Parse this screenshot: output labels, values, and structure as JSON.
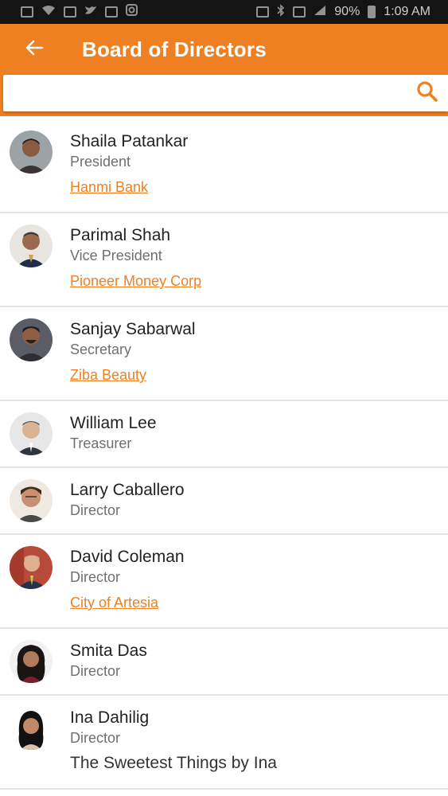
{
  "status_bar": {
    "battery": "90%",
    "time": "1:09 AM"
  },
  "header": {
    "title": "Board of Directors"
  },
  "search": {
    "placeholder": "",
    "value": ""
  },
  "colors": {
    "accent": "#ef8022",
    "status_bar": "#141414",
    "divider": "#e3e3e3"
  },
  "members": [
    {
      "name": "Shaila Patankar",
      "role": "President",
      "company": "Hanmi Bank",
      "company_is_link": true
    },
    {
      "name": "Parimal Shah",
      "role": "Vice President",
      "company": "Pioneer Money Corp",
      "company_is_link": true
    },
    {
      "name": "Sanjay Sabarwal",
      "role": "Secretary",
      "company": "Ziba Beauty",
      "company_is_link": true
    },
    {
      "name": "William Lee",
      "role": "Treasurer",
      "company": "",
      "company_is_link": false
    },
    {
      "name": "Larry Caballero",
      "role": "Director",
      "company": "",
      "company_is_link": false
    },
    {
      "name": "David Coleman",
      "role": "Director",
      "company": "City of Artesia",
      "company_is_link": true
    },
    {
      "name": "Smita Das",
      "role": "Director",
      "company": "",
      "company_is_link": false
    },
    {
      "name": "Ina Dahilig",
      "role": "Director",
      "company": "The Sweetest Things by Ina",
      "company_is_link": false
    }
  ]
}
